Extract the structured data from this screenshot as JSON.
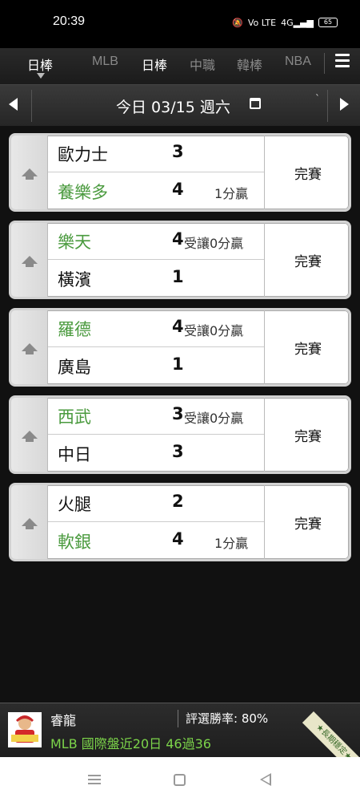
{
  "status_bar": {
    "time": "20:39",
    "icons": [
      "mute-icon",
      "volte-icon",
      "signal-icon",
      "battery-icon"
    ],
    "volte": "Vo LTE",
    "network": "4G",
    "battery": "65"
  },
  "tabs": [
    {
      "label": "日棒",
      "active": true
    },
    {
      "label": "MLB",
      "active": false
    },
    {
      "label": "日棒",
      "active": true
    },
    {
      "label": "中職",
      "active": false
    },
    {
      "label": "韓棒",
      "active": false
    },
    {
      "label": "NBA",
      "active": false
    }
  ],
  "date_bar": {
    "label": "今日 03/15 週六",
    "mark": "`"
  },
  "games": [
    {
      "home": {
        "team": "歐力士",
        "score": "3",
        "note": "",
        "winner": false
      },
      "away": {
        "team": "養樂多",
        "score": "4",
        "note": "1分贏",
        "winner": true
      },
      "status": "完賽"
    },
    {
      "home": {
        "team": "樂天",
        "score": "4",
        "note": "受讓0分贏",
        "winner": true
      },
      "away": {
        "team": "橫濱",
        "score": "1",
        "note": "",
        "winner": false
      },
      "status": "完賽"
    },
    {
      "home": {
        "team": "羅德",
        "score": "4",
        "note": "受讓0分贏",
        "winner": true
      },
      "away": {
        "team": "廣島",
        "score": "1",
        "note": "",
        "winner": false
      },
      "status": "完賽"
    },
    {
      "home": {
        "team": "西武",
        "score": "3",
        "note": "受讓0分贏",
        "winner": true
      },
      "away": {
        "team": "中日",
        "score": "3",
        "note": "",
        "winner": false
      },
      "status": "完賽"
    },
    {
      "home": {
        "team": "火腿",
        "score": "2",
        "note": "",
        "winner": false
      },
      "away": {
        "team": "軟銀",
        "score": "4",
        "note": "1分贏",
        "winner": true
      },
      "status": "完賽"
    }
  ],
  "ad": {
    "name": "睿龍",
    "rate": "評選勝率: 80%",
    "record": "MLB 國際盤近20日 46過36",
    "ribbon": "★長期穩定★"
  },
  "colors": {
    "winner": "#4a9a3e",
    "record": "#7cd44a",
    "card_bg": "#ffffff",
    "page_bg": "#111111"
  }
}
